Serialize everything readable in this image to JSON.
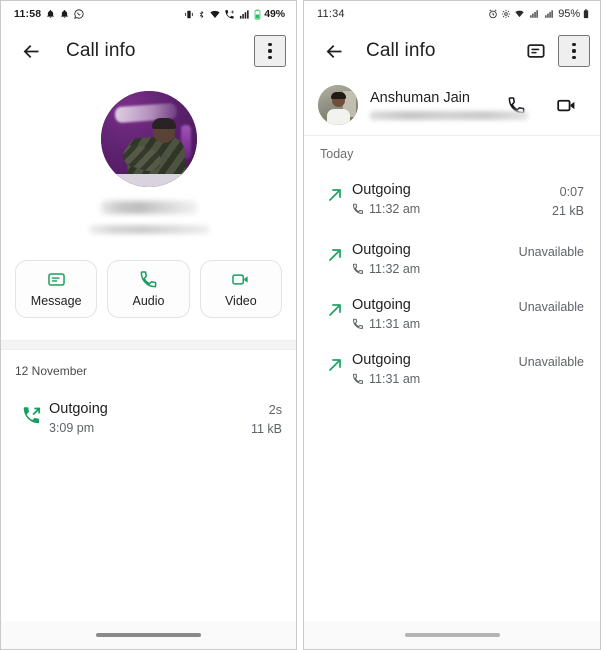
{
  "left_panel": {
    "status_bar": {
      "time": "11:58",
      "battery": "49%",
      "icons": [
        "notification-bell-icon",
        "notification-bell-icon",
        "whatsapp-icon",
        "vibrate-icon",
        "bluetooth-icon",
        "wifi-icon",
        "call-forwarding-icon",
        "cellular-signal-icon",
        "battery-icon"
      ]
    },
    "app_bar": {
      "back_label": "back-arrow",
      "title": "Call info",
      "overflow_label": "more-options"
    },
    "hero": {
      "avatar_alt": "contact-photo",
      "name_redacted": true,
      "subtitle_redacted": true
    },
    "actions": [
      {
        "id": "message",
        "label": "Message",
        "icon": "message-icon"
      },
      {
        "id": "audio",
        "label": "Audio",
        "icon": "phone-icon"
      },
      {
        "id": "video",
        "label": "Video",
        "icon": "video-camera-icon"
      }
    ],
    "date_header": "12 November",
    "calls": [
      {
        "type": "Outgoing",
        "time": "3:09 pm",
        "duration": "2s",
        "data": "11 kB",
        "icon": "outgoing-call-icon"
      }
    ]
  },
  "right_panel": {
    "status_bar": {
      "time": "11:34",
      "battery": "95%",
      "icons": [
        "alarm-icon",
        "settings-icon",
        "wifi-icon",
        "sim1-signal-icon",
        "sim2-signal-icon",
        "battery-icon"
      ]
    },
    "app_bar": {
      "back_label": "back-arrow",
      "title": "Call info",
      "message_label": "message-notes",
      "overflow_label": "more-options"
    },
    "contact": {
      "name": "Anshuman Jain",
      "status_redacted": true,
      "avatar_alt": "contact-photo",
      "call_action": "phone-icon",
      "video_action": "video-camera-icon"
    },
    "date_header": "Today",
    "calls": [
      {
        "type": "Outgoing",
        "time": "11:32 am",
        "duration": "0:07",
        "data": "21 kB",
        "icon": "outgoing-arrow-icon"
      },
      {
        "type": "Outgoing",
        "time": "11:32 am",
        "duration": "Unavailable",
        "data": "",
        "icon": "outgoing-arrow-icon"
      },
      {
        "type": "Outgoing",
        "time": "11:31 am",
        "duration": "Unavailable",
        "data": "",
        "icon": "outgoing-arrow-icon"
      },
      {
        "type": "Outgoing",
        "time": "11:31 am",
        "duration": "Unavailable",
        "data": "",
        "icon": "outgoing-arrow-icon"
      }
    ]
  },
  "colors": {
    "accent_green": "#1a9e5f",
    "text_primary": "#1f1f1f",
    "text_secondary": "#5f6368",
    "surface": "#ffffff",
    "divider": "#eeeeee"
  }
}
